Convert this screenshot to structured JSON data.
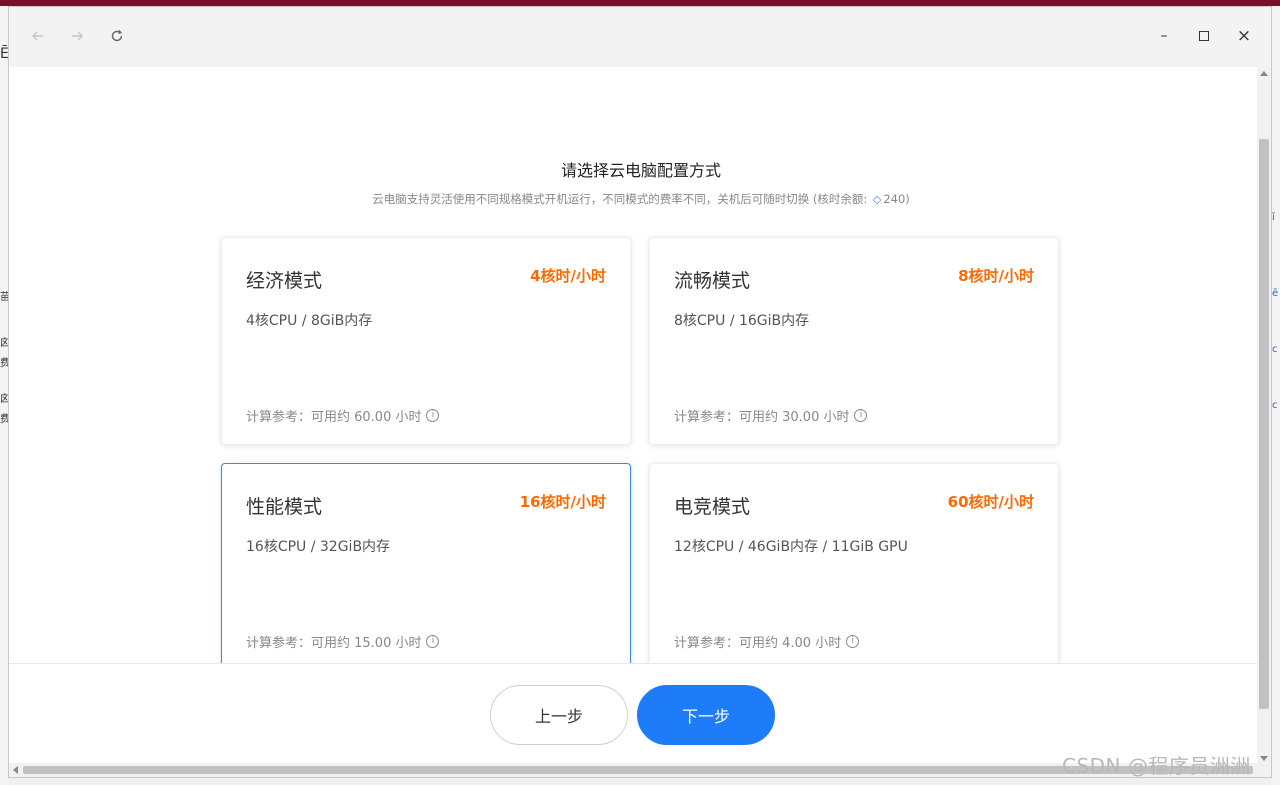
{
  "window": {
    "controls": {
      "back_icon": "arrow-left-icon",
      "forward_icon": "arrow-right-icon",
      "reload_icon": "reload-icon",
      "minimize_glyph": "–",
      "close_glyph": "×"
    }
  },
  "page": {
    "title": "请选择云电脑配置方式",
    "subtitle_prefix": "云电脑支持灵活使用不同规格模式开机运行，不同模式的费率不同，关机后可随时切换 (核时余额: ",
    "balance": "240",
    "subtitle_suffix": ")"
  },
  "modes": [
    {
      "name": "经济模式",
      "rate": "4核时/小时",
      "spec": "4核CPU / 8GiB内存",
      "estimate": "计算参考：可用约 60.00 小时",
      "selected": false
    },
    {
      "name": "流畅模式",
      "rate": "8核时/小时",
      "spec": "8核CPU / 16GiB内存",
      "estimate": "计算参考：可用约 30.00 小时",
      "selected": false
    },
    {
      "name": "性能模式",
      "rate": "16核时/小时",
      "spec": "16核CPU / 32GiB内存",
      "estimate": "计算参考：可用约 15.00 小时",
      "selected": true
    },
    {
      "name": "电竞模式",
      "rate": "60核时/小时",
      "spec": "12核CPU / 46GiB内存 / 11GiB GPU",
      "estimate": "计算参考：可用约 4.00 小时",
      "selected": false
    }
  ],
  "footer": {
    "prev_label": "上一步",
    "next_label": "下一步"
  },
  "colors": {
    "accent": "#1f7cf8",
    "rate": "#ff6a00",
    "selected_border": "#3a86f0",
    "title_accent": "#7a0f2b"
  },
  "watermark": "CSDN @程序员洲洲",
  "background_fragments": {
    "left": [
      "Ē",
      "苗",
      "囟",
      "费",
      "囟",
      "费"
    ],
    "right": [
      "ī",
      "ē",
      "c",
      "c"
    ]
  }
}
